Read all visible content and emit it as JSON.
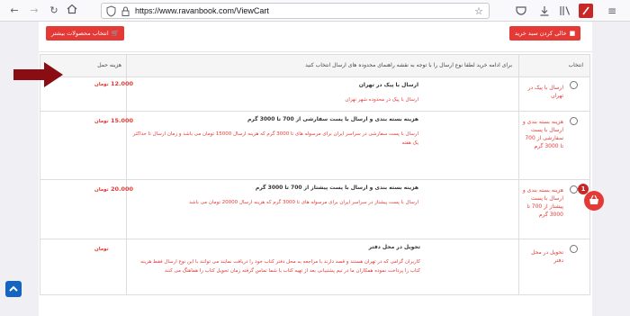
{
  "browser": {
    "url": "https://www.ravanbook.com/ViewCart"
  },
  "actions": {
    "more_products_label": "انتخاب محصولات بیشتر",
    "empty_cart_label": "خالی کردن سبد خرید"
  },
  "table": {
    "col_select": "انتخاب",
    "col_description": "برای ادامه خرید لطفا نوع ارسال را با توجه به نقشه راهنمای محدوده های ارسال انتخاب کنید",
    "col_cost": "هزینه حمل",
    "rows": [
      {
        "method": "ارسال با پیک در تهران",
        "title": "ارسال با پیک در تهران",
        "text": "ارسال با پیک در محدوده شهر تهران",
        "price": "12.000",
        "currency": "تومان"
      },
      {
        "method": "هزینه بسته بندی و ارسال با پست سفارشی از 700 تا 3000 گرم",
        "title": "هزینه بسته بندی و ارسال با پست سفارشی از 700 تا 3000 گرم",
        "text": "ارسال با پست سفارشی در سراسر ایران برای مرسوله های تا 3000 گرم که هزینه ارسال 15000 تومان می باشد و زمان ارسال تا حداکثر یک هفته",
        "price": "15.000",
        "currency": "تومان"
      },
      {
        "method": "هزینه بسته بندی و ارسال با پست پیشتاز از 700 تا 3000 گرم",
        "title": "هزینه بسته بندی و ارسال با پست پیشتاز از 700 تا 3000 گرم",
        "text": "ارسال با پست پیشتاز در سراسر ایران برای مرسوله های تا 3000 گرم که هزینه ارسال 20000 تومان می باشد",
        "price": "20.000",
        "currency": "تومان"
      },
      {
        "method": "تحویل در محل دفتر",
        "title": "تحویل در محل دفتر",
        "text": "کاربران گرامی که در تهران هستند و قصد دارند با مراجعه به محل دفتر کتاب خود را دریافت نمایند می توانند با این نوع ارسال فقط هزینه کتاب را پرداخت نموده همکاران ما در تیم پشتیبانی بعد از تهیه کتاب با شما تماس گرفته زمان تحویل کتاب را هماهنگ می کنند",
        "price": "",
        "currency": "تومان"
      }
    ]
  },
  "cart": {
    "badge_count": "1"
  },
  "colors": {
    "accent": "#e53935",
    "scroll_button": "#1565c0",
    "arrow": "#8b0d14"
  }
}
